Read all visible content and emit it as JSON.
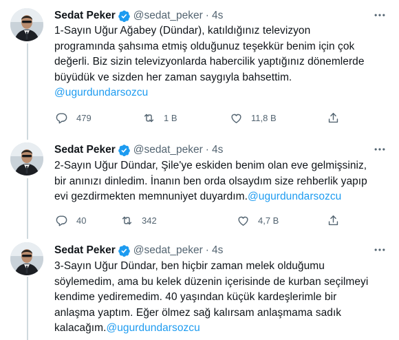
{
  "tweets": [
    {
      "name": "Sedat Peker",
      "handle": "@sedat_peker",
      "separator": "·",
      "time": "4s",
      "lines": [
        "1-Sayın Uğur Ağabey (Dündar), katıldığınız televizyon",
        "programında şahsıma etmiş olduğunuz teşekkür benim için çok",
        "değerli. Biz sizin televizyonlarda habercilik yaptığınız dönemlerde",
        "büyüdük ve sizden her zaman saygıyla bahsettim."
      ],
      "mention_line": "@ugurdundarsozcu",
      "replies": "479",
      "retweets": "1 B",
      "likes": "11,8 B"
    },
    {
      "name": "Sedat Peker",
      "handle": "@sedat_peker",
      "separator": "·",
      "time": "4s",
      "lines": [
        "2-Sayın Uğur Dündar, Şile'ye eskiden benim olan eve gelmişsiniz,",
        "bir anınızı dinledim. İnanın ben orda olsaydım size rehberlik yapıp"
      ],
      "last_line_text": "evi gezdirmekten memnuniyet duyardım.",
      "last_line_mention": "@ugurdundarsozcu",
      "replies": "40",
      "retweets": "342",
      "likes": "4,7 B"
    },
    {
      "name": "Sedat Peker",
      "handle": "@sedat_peker",
      "separator": "·",
      "time": "4s",
      "lines": [
        "3-Sayın Uğur Dündar, ben hiçbir zaman melek olduğumu",
        "söylemedim, ama bu kelek düzenin içerisinde de kurban seçilmeyi",
        "kendime yediremedim. 40 yaşından küçük kardeşlerimle bir",
        "anlaşma yaptım. Eğer ölmez sağ kalırsam anlaşmama sadık"
      ],
      "last_line_text": "kalacağım.",
      "last_line_mention": "@ugurdundarsozcu"
    }
  ],
  "icons": {
    "verified": "verified-badge-icon",
    "more": "more-icon",
    "reply": "reply-icon",
    "retweet": "retweet-icon",
    "like": "heart-icon",
    "share": "share-icon"
  },
  "colors": {
    "mention": "#1d9bf0",
    "verified": "#1d9bf0",
    "secondary_text": "#536471",
    "thread_line": "#cfd9de"
  }
}
